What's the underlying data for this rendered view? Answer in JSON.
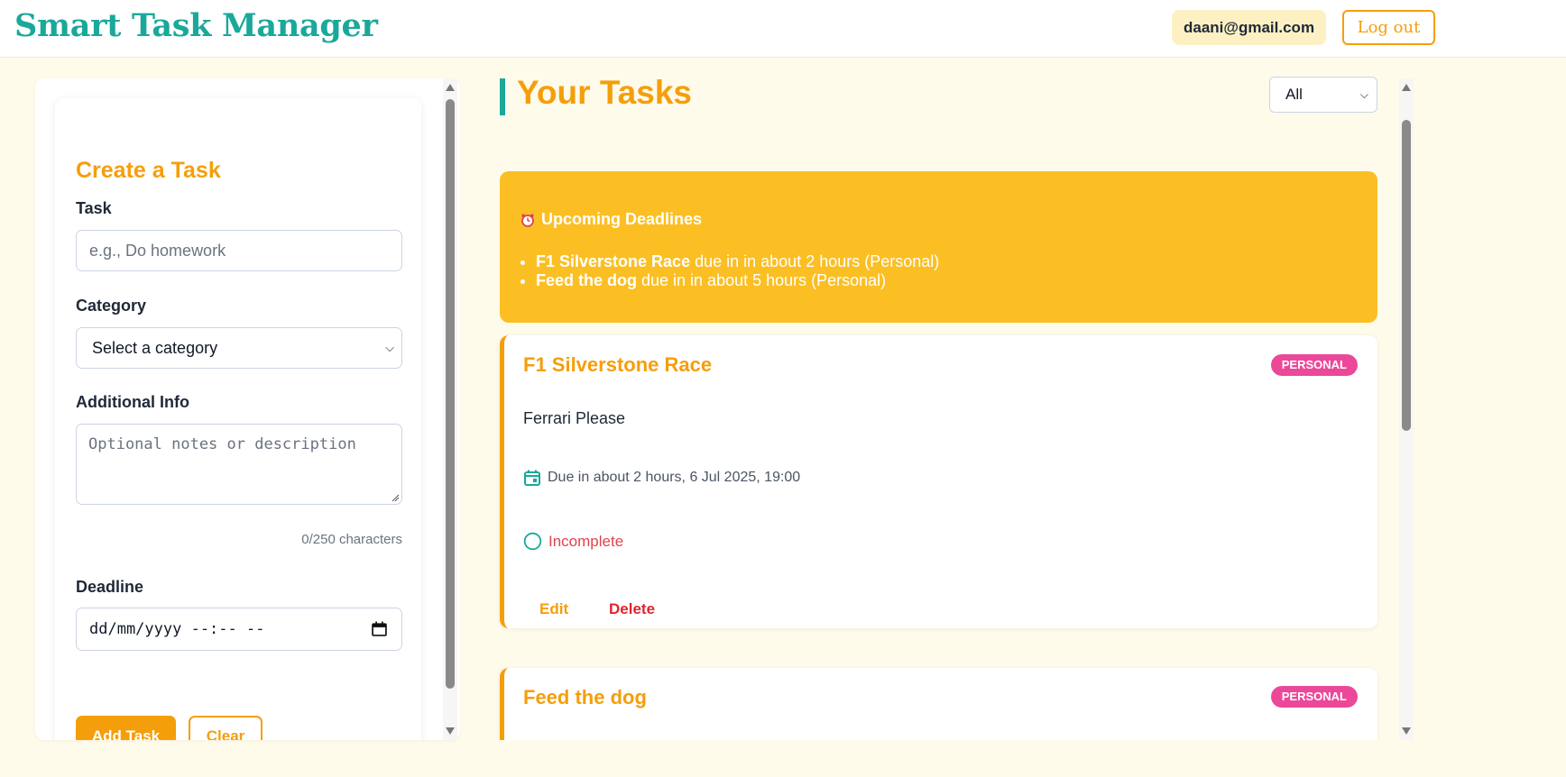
{
  "header": {
    "brand": "Smart Task Manager",
    "user_email": "daani@gmail.com",
    "logout_label": "Log out"
  },
  "form": {
    "title": "Create a Task",
    "task_label": "Task",
    "task_placeholder": "e.g., Do homework",
    "category_label": "Category",
    "category_selected": "Select a category",
    "info_label": "Additional Info",
    "info_placeholder": "Optional notes or description",
    "char_count": "0/250 characters",
    "deadline_label": "Deadline",
    "deadline_placeholder": "dd/mm/yyyy --:-- --",
    "add_label": "Add Task",
    "clear_label": "Clear"
  },
  "main": {
    "title": "Your Tasks",
    "filter_selected": "All",
    "deadlines": {
      "heading": "Upcoming Deadlines",
      "items": [
        {
          "name": "F1 Silverstone Race",
          "rest": " due in in about 2 hours (Personal)"
        },
        {
          "name": "Feed the dog",
          "rest": " due in in about 5 hours (Personal)"
        }
      ]
    },
    "tasks": [
      {
        "title": "F1 Silverstone Race",
        "badge": "PERSONAL",
        "description": "Ferrari Please",
        "due": "Due in about 2 hours, 6 Jul 2025, 19:00",
        "status": "Incomplete",
        "edit_label": "Edit",
        "delete_label": "Delete"
      },
      {
        "title": "Feed the dog",
        "badge": "PERSONAL"
      }
    ]
  },
  "colors": {
    "brand": "#1aa89a",
    "accent": "#f59e0b",
    "deadline_bg": "#fbbf24",
    "badge": "#ec4899",
    "danger": "#e0242f"
  },
  "icons": {
    "alarm": "alarm-clock-icon",
    "calendar": "calendar-icon",
    "status": "circle-outline-icon"
  }
}
